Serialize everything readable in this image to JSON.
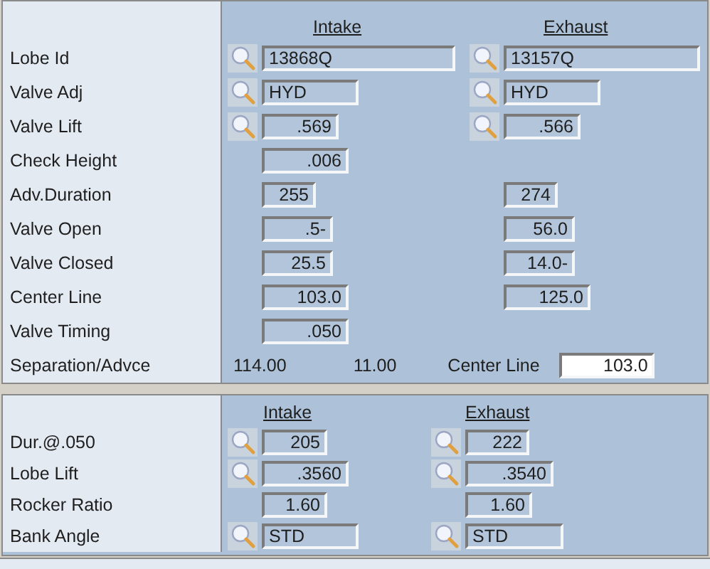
{
  "cam_panel": {
    "headers": [
      "Intake",
      "Exhaust"
    ],
    "rows": [
      {
        "label": "Lobe Id",
        "intake": {
          "value": "13868Q",
          "lookup": true,
          "kind": "text"
        },
        "exhaust": {
          "value": "13157Q",
          "lookup": true,
          "kind": "text"
        }
      },
      {
        "label": "Valve Adj",
        "intake": {
          "value": "HYD",
          "lookup": true,
          "kind": "text"
        },
        "exhaust": {
          "value": "HYD",
          "lookup": true,
          "kind": "text"
        }
      },
      {
        "label": "Valve Lift",
        "intake": {
          "value": ".569",
          "lookup": true,
          "kind": "number"
        },
        "exhaust": {
          "value": ".566",
          "lookup": true,
          "kind": "number"
        }
      },
      {
        "label": "Check Height",
        "intake": {
          "value": ".006",
          "lookup": false,
          "kind": "number"
        }
      },
      {
        "label": "Adv.Duration",
        "intake": {
          "value": "255",
          "lookup": false,
          "kind": "number"
        },
        "exhaust": {
          "value": "274",
          "lookup": false,
          "kind": "number"
        }
      },
      {
        "label": "Valve Open",
        "intake": {
          "value": ".5-",
          "lookup": false,
          "kind": "number"
        },
        "exhaust": {
          "value": "56.0",
          "lookup": false,
          "kind": "number"
        }
      },
      {
        "label": "Valve Closed",
        "intake": {
          "value": "25.5",
          "lookup": false,
          "kind": "number"
        },
        "exhaust": {
          "value": "14.0-",
          "lookup": false,
          "kind": "number"
        }
      },
      {
        "label": "Center Line",
        "intake": {
          "value": "103.0",
          "lookup": false,
          "kind": "number"
        },
        "exhaust": {
          "value": "125.0",
          "lookup": false,
          "kind": "number"
        }
      },
      {
        "label": "Valve Timing",
        "intake": {
          "value": ".050",
          "lookup": false,
          "kind": "number"
        }
      }
    ],
    "separation": {
      "label": "Separation/Advce",
      "values": [
        "114.00",
        "11.00"
      ],
      "center_line_label": "Center Line",
      "center_line_value": "103.0"
    }
  },
  "lobe_panel": {
    "headers": [
      "Intake",
      "Exhaust"
    ],
    "rows": [
      {
        "label": "Dur.@.050",
        "intake": {
          "value": "205",
          "lookup": true,
          "kind": "number"
        },
        "exhaust": {
          "value": "222",
          "lookup": true,
          "kind": "number"
        }
      },
      {
        "label": "Lobe Lift",
        "intake": {
          "value": ".3560",
          "lookup": true,
          "kind": "number"
        },
        "exhaust": {
          "value": ".3540",
          "lookup": true,
          "kind": "number"
        }
      },
      {
        "label": "Rocker Ratio",
        "intake": {
          "value": "1.60",
          "lookup": false,
          "kind": "number"
        },
        "exhaust": {
          "value": "1.60",
          "lookup": false,
          "kind": "number"
        }
      },
      {
        "label": "Bank Angle",
        "intake": {
          "value": "STD",
          "lookup": true,
          "kind": "text"
        },
        "exhaust": {
          "value": "STD",
          "lookup": true,
          "kind": "text"
        }
      }
    ]
  }
}
